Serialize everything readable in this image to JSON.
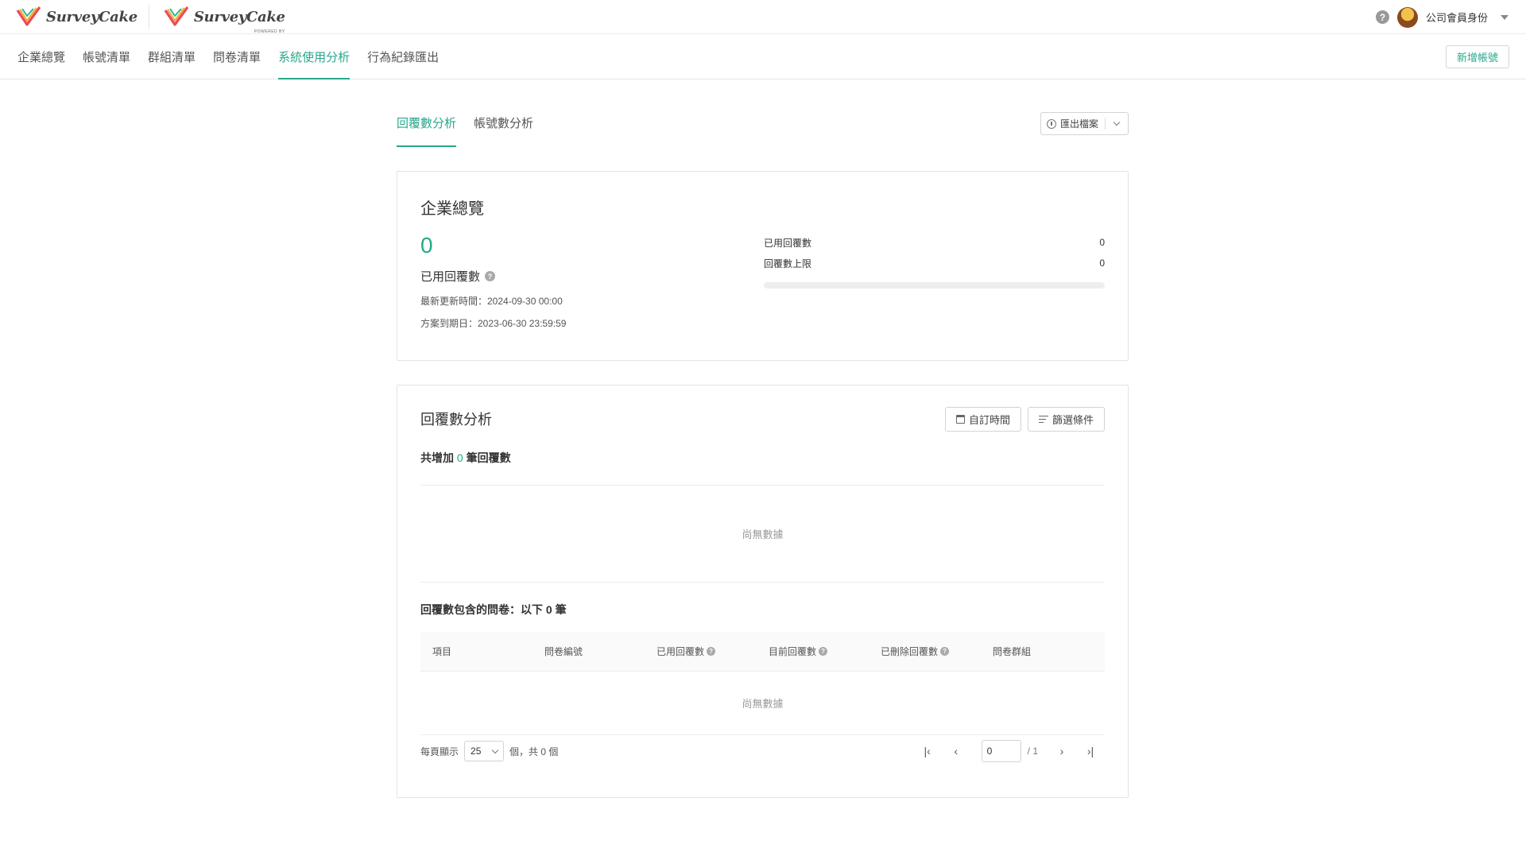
{
  "header": {
    "logo_text": "SurveyCake",
    "logo2_text": "SurveyCake",
    "logo2_sub": "POWERED BY",
    "help_icon": "question-circle-icon",
    "user_name": "公司會員身份"
  },
  "nav": {
    "items": [
      "企業總覽",
      "帳號清單",
      "群組清單",
      "問卷清單",
      "系統使用分析",
      "行為紀錄匯出"
    ],
    "active_index": 4,
    "new_account_label": "新增帳號"
  },
  "subtabs": {
    "items": [
      "回覆數分析",
      "帳號數分析"
    ],
    "active_index": 0,
    "export_label": "匯出檔案"
  },
  "overview": {
    "title": "企業總覽",
    "used_count": "0",
    "used_label": "已用回覆數",
    "updated_line": "最新更新時間：2024-09-30 00:00",
    "expiry_line": "方案到期日：2023-06-30 23:59:59",
    "stats": [
      {
        "label": "已用回覆數",
        "value": "0"
      },
      {
        "label": "回覆數上限",
        "value": "0"
      }
    ],
    "progress": 0
  },
  "analysis": {
    "title": "回覆數分析",
    "custom_time_label": "自訂時間",
    "filter_label": "篩選條件",
    "summary_prefix": "共增加",
    "summary_count": "0",
    "summary_suffix": "筆回覆數",
    "no_data": "尚無數據",
    "table_title": "回覆數包含的問卷：以下 0 筆",
    "columns": [
      "項目",
      "問卷編號",
      "已用回覆數",
      "目前回覆數",
      "已刪除回覆數",
      "問卷群組"
    ],
    "table_empty": "尚無數據",
    "pager": {
      "per_page_label": "每頁顯示",
      "per_page_value": "25",
      "total_label": "個，共 0 個",
      "current_page": "0",
      "total_pages": "/ 1"
    }
  }
}
